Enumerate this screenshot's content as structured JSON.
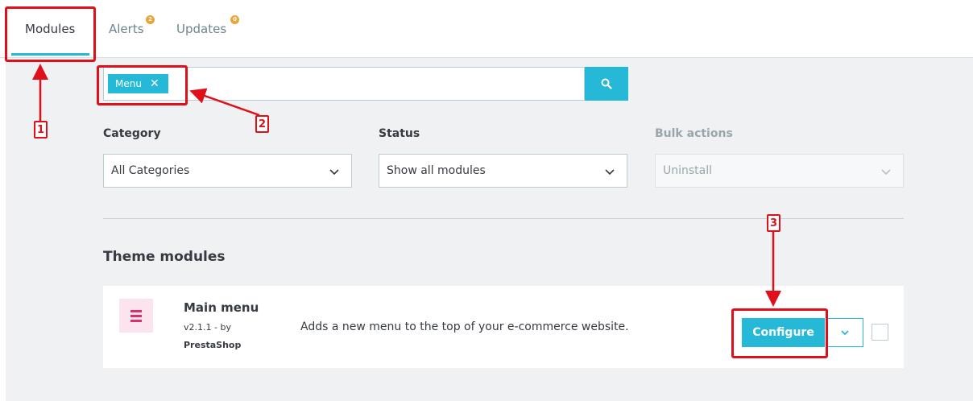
{
  "tabs": [
    {
      "label": "Modules",
      "badge": ""
    },
    {
      "label": "Alerts",
      "badge": "2"
    },
    {
      "label": "Updates",
      "badge": "0"
    }
  ],
  "search": {
    "tag_label": "Menu"
  },
  "filters": {
    "category_label": "Category",
    "category_value": "All Categories",
    "status_label": "Status",
    "status_value": "Show all modules",
    "bulk_label": "Bulk actions",
    "bulk_value": "Uninstall"
  },
  "section": {
    "title": "Theme modules"
  },
  "module": {
    "name": "Main menu",
    "version": "v2.1.1 - by",
    "author": "PrestaShop",
    "description": "Adds a new menu to the top of your e-commerce website.",
    "configure_label": "Configure"
  },
  "annotations": [
    "1",
    "2",
    "3"
  ],
  "colors": {
    "accent": "#25b9d7",
    "annotation": "#e0101a",
    "badge": "#e7a53b",
    "module_icon": "#d6336c"
  }
}
